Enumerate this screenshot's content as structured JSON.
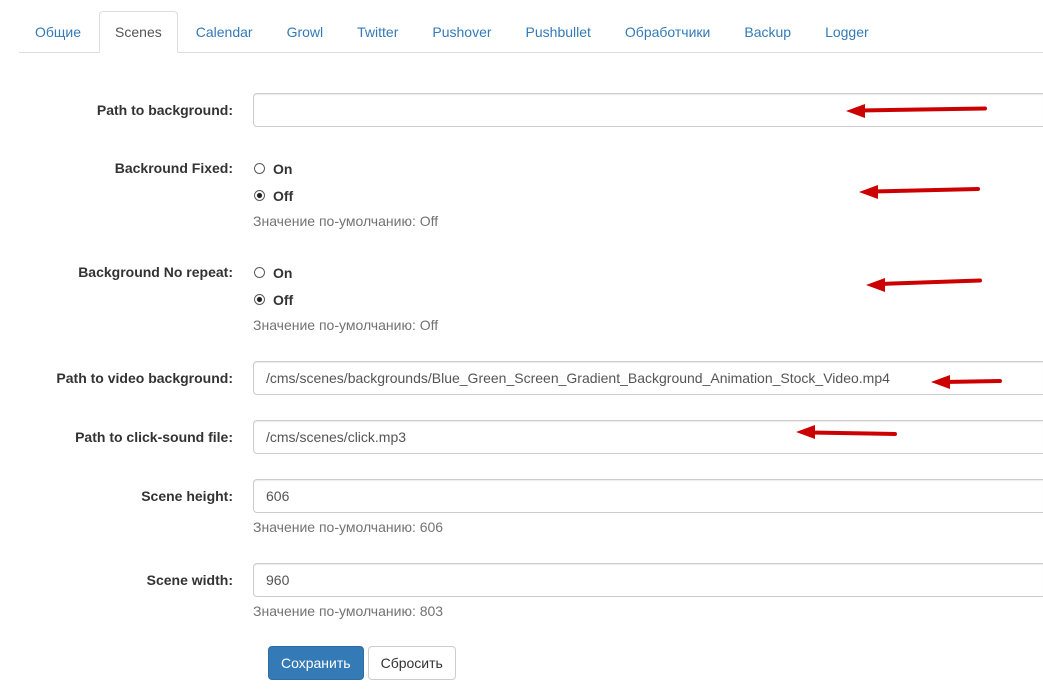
{
  "tabs": [
    {
      "label": "Общие",
      "active": false
    },
    {
      "label": "Scenes",
      "active": true
    },
    {
      "label": "Calendar",
      "active": false
    },
    {
      "label": "Growl",
      "active": false
    },
    {
      "label": "Twitter",
      "active": false
    },
    {
      "label": "Pushover",
      "active": false
    },
    {
      "label": "Pushbullet",
      "active": false
    },
    {
      "label": "Обработчики",
      "active": false
    },
    {
      "label": "Backup",
      "active": false
    },
    {
      "label": "Logger",
      "active": false
    }
  ],
  "form": {
    "path_to_background": {
      "label": "Path to background:",
      "value": ""
    },
    "background_fixed": {
      "label": "Backround Fixed:",
      "options": [
        {
          "label": "On",
          "checked": false
        },
        {
          "label": "Off",
          "checked": true
        }
      ],
      "help": "Значение по-умолчанию: Off"
    },
    "background_no_repeat": {
      "label": "Background No repeat:",
      "options": [
        {
          "label": "On",
          "checked": false
        },
        {
          "label": "Off",
          "checked": true
        }
      ],
      "help": "Значение по-умолчанию: Off"
    },
    "path_to_video_background": {
      "label": "Path to video background:",
      "value": "/cms/scenes/backgrounds/Blue_Green_Screen_Gradient_Background_Animation_Stock_Video.mp4"
    },
    "path_to_click_sound": {
      "label": "Path to click-sound file:",
      "value": "/cms/scenes/click.mp3"
    },
    "scene_height": {
      "label": "Scene height:",
      "value": "606",
      "help": "Значение по-умолчанию: 606"
    },
    "scene_width": {
      "label": "Scene width:",
      "value": "960",
      "help": "Значение по-умолчанию: 803"
    }
  },
  "buttons": {
    "save_label": "Сохранить",
    "reset_label": "Сбросить"
  },
  "colors": {
    "link": "#337ab7",
    "primary_button": "#337ab7",
    "help_text": "#737373",
    "annotation_arrow": "#cc0000"
  }
}
